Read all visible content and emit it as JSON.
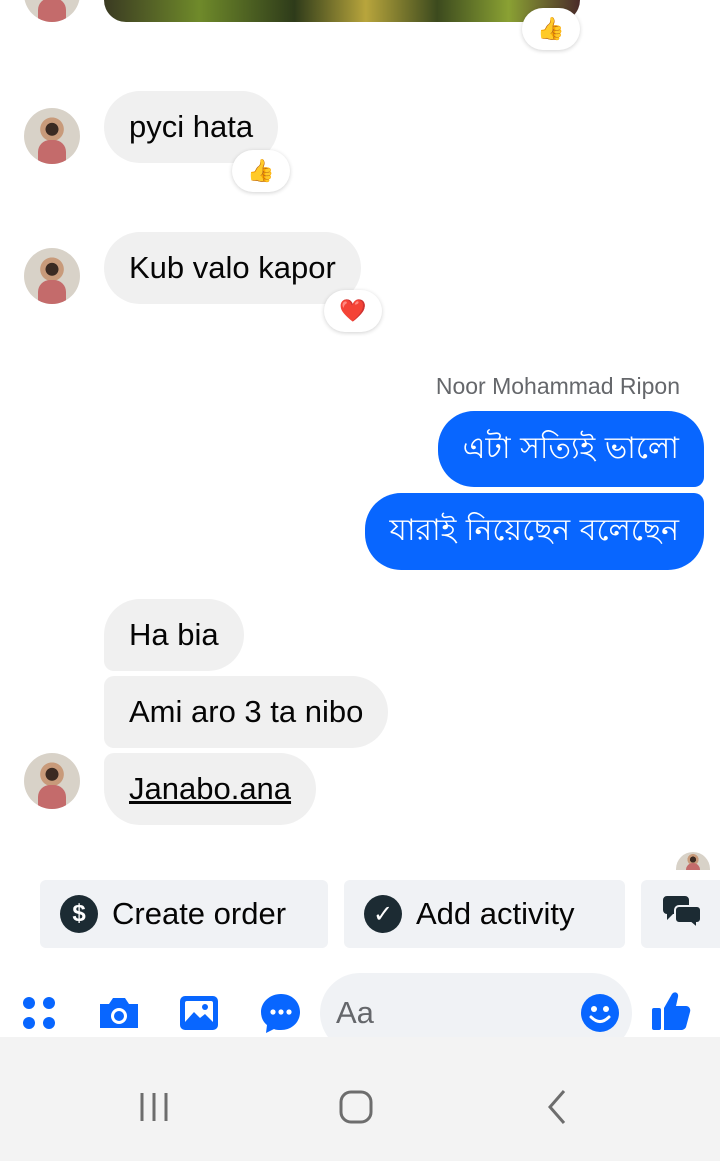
{
  "messages": {
    "pyci": "pyci hata",
    "kub": "Kub valo kapor",
    "ha_bia": "Ha bia",
    "ami": "Ami aro 3 ta nibo",
    "janabo": "Janabo.ana"
  },
  "reactions": {
    "top": "👍",
    "pyci": "👍",
    "kub": "❤️"
  },
  "sender_name": "Noor Mohammad Ripon",
  "outgoing": {
    "line1": "এটা সত্যিই ভালো",
    "line2": "যারাই নিয়েছেন বলেছেন"
  },
  "quick_actions": {
    "create_order": "Create order",
    "add_activity": "Add activity"
  },
  "composer": {
    "placeholder": "Aa"
  },
  "colors": {
    "accent": "#0866ff",
    "incoming_bubble": "#f0f0f0",
    "chip_bg": "#f0f2f5"
  }
}
